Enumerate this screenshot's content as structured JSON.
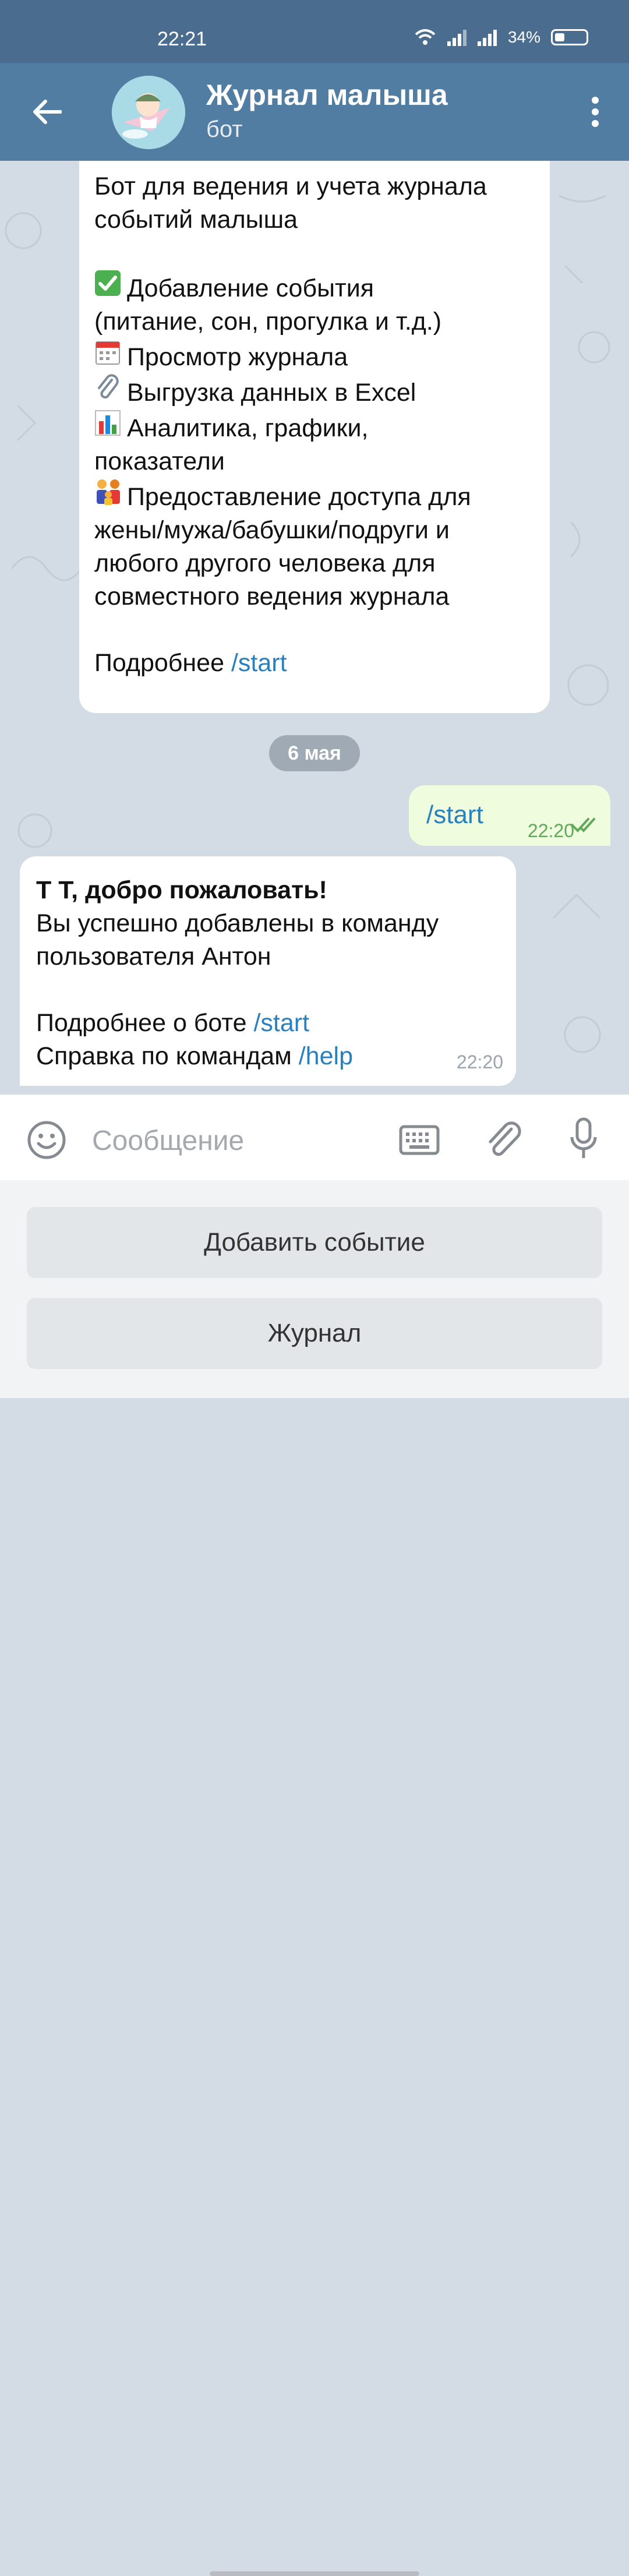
{
  "status_bar": {
    "time": "22:21",
    "battery": "34%"
  },
  "header": {
    "title": "Журнал малыша",
    "subtitle": "бот"
  },
  "messages": {
    "intro": {
      "lines": [
        "Бот для ведения и учета журнала",
        "событий малыша",
        "",
        "Добавление события",
        "(питание, сон, прогулка и т.д.)",
        "Просмотр журнала",
        "Выгрузка данных в Excel",
        "Аналитика, графики,",
        "показатели",
        "Предоставление доступа для",
        "жены/мужа/бабушки/подруги и",
        "любого другого человека для",
        "совместного ведения журнала"
      ],
      "more_prefix": "Подробнее ",
      "more_link": "/start"
    },
    "date_separator": "6 мая",
    "outgoing": {
      "text": "/start",
      "time": "22:20"
    },
    "incoming": {
      "title": "Т Т, добро пожаловать!",
      "line1": "Вы успешно добавлены в команду",
      "line2": "пользователя Антон",
      "about_prefix": "Подробнее о боте ",
      "about_link": "/start",
      "help_prefix": "Справка по командам ",
      "help_link": "/help",
      "time": "22:20"
    }
  },
  "input": {
    "placeholder": "Сообщение"
  },
  "keyboard_buttons": [
    "Добавить событие",
    "Журнал"
  ],
  "colors": {
    "header": "#517da2",
    "link": "#2a7fbf",
    "outgoing_bubble": "#effdde"
  }
}
